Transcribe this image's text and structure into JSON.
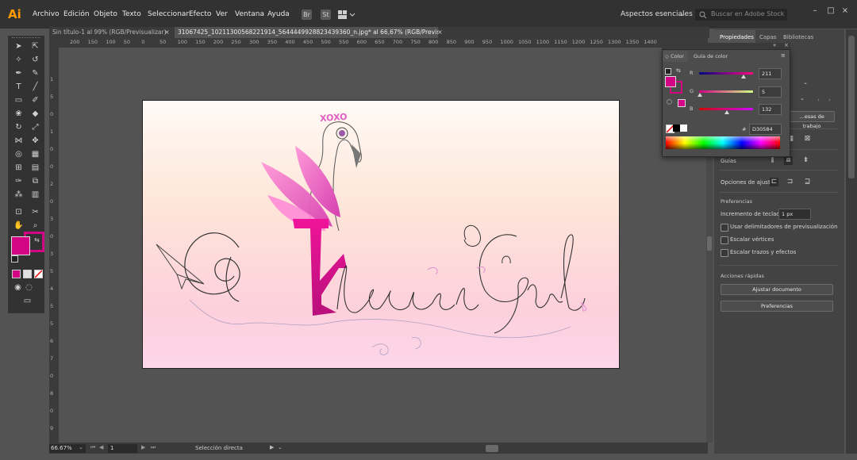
{
  "app": {
    "logo": "Ai"
  },
  "menu": [
    "Archivo",
    "Edición",
    "Objeto",
    "Texto",
    "Seleccionar",
    "Efecto",
    "Ver",
    "Ventana",
    "Ayuda"
  ],
  "menubar": {
    "bridge_icon": "Br",
    "stock_icon": "St",
    "workspace": "Aspectos esenciales",
    "search_placeholder": "Buscar en Adobe Stock"
  },
  "tabs": [
    {
      "label": "Sin título-1 al 99% (RGB/Previsualizar)",
      "close": "×"
    },
    {
      "label": "31067425_1021130056822191​4_5644449928823439360_n.jpg* al 66,67% (RGB/Previsualizar)",
      "close": "×"
    }
  ],
  "ruler": {
    "top": [
      "200",
      "150",
      "100",
      "50",
      "0",
      "50",
      "100",
      "150",
      "200",
      "250",
      "300",
      "350",
      "400",
      "450",
      "500",
      "550",
      "600",
      "650",
      "700",
      "750",
      "800",
      "850",
      "900",
      "950",
      "1000",
      "1050",
      "1100",
      "1150",
      "1200",
      "1250",
      "1300",
      "1350",
      "1400"
    ],
    "left": [
      "1",
      "5",
      "0",
      "1",
      "0",
      "0",
      "2",
      "0",
      "3",
      "0",
      "3",
      "5",
      "4",
      "5",
      "5",
      "6",
      "7",
      "0",
      "8",
      "0",
      "9"
    ]
  },
  "artwork": {
    "crown_text": "XOXO",
    "logo_text": "@FlaminGirl"
  },
  "status": {
    "zoom": "66.67%",
    "artboard": "1",
    "tool": "Selección directa"
  },
  "properties_panel": {
    "tabs": [
      "Propiedades",
      "Capas",
      "Bibliotecas"
    ],
    "artboard_options_button": "…esas de trabajo",
    "guides_label": "Guías",
    "snap_label": "Opciones de ajuste",
    "preferences_title": "Preferencias",
    "keyboard_increment_label": "Incremento de teclado:",
    "keyboard_increment_value": "1 px",
    "checkboxes": [
      "Usar delimitadores de previsualización",
      "Escalar vértices",
      "Escalar trazos y efectos"
    ],
    "quick_actions_title": "Acciones rápidas",
    "fit_document_button": "Ajustar documento",
    "preferences_button": "Preferencias"
  },
  "color_panel": {
    "tabs": [
      "Color",
      "Guía de color"
    ],
    "sliders": [
      {
        "channel": "R",
        "value": "211",
        "fraction": 0.827
      },
      {
        "channel": "G",
        "value": "5",
        "fraction": 0.02
      },
      {
        "channel": "B",
        "value": "132",
        "fraction": 0.518
      }
    ],
    "hex_label": "#",
    "hex": "D30584"
  },
  "colors": {
    "fill": "#D30584",
    "stroke": "#D30584",
    "accent": "#ff9a00"
  }
}
